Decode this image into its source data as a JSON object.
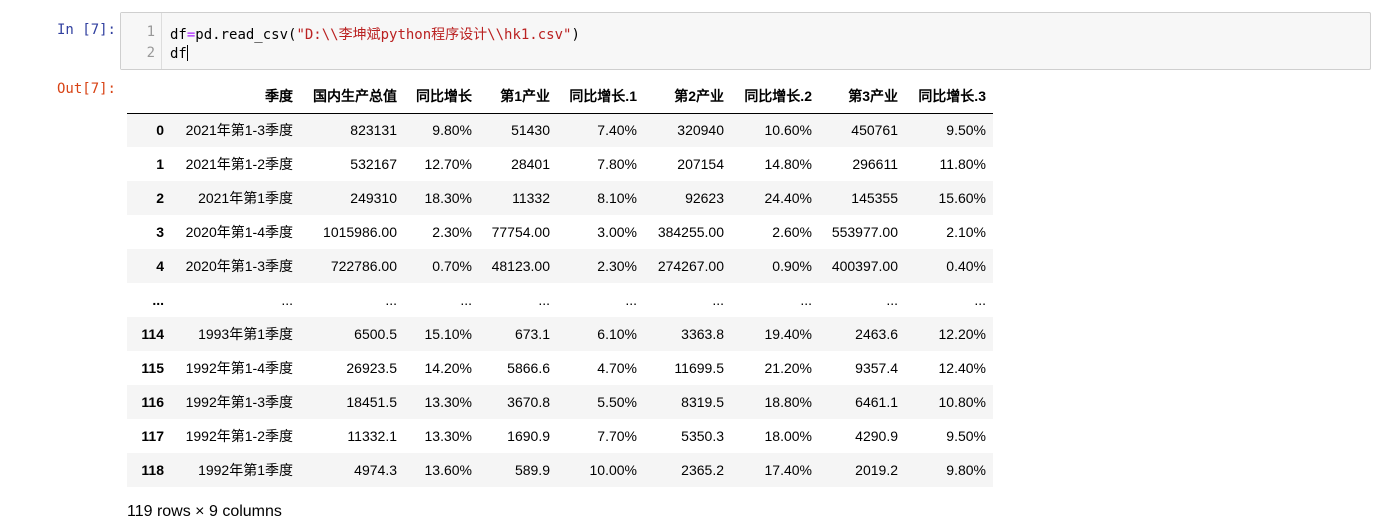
{
  "input_cell": {
    "prompt": "In  [7]:",
    "lines": [
      {
        "no": "1",
        "pre": "df",
        "op": "=",
        "mid": "pd.read_csv(",
        "str": "\"D:\\\\李坤斌python程序设计\\\\hk1.csv\"",
        "post": ")"
      },
      {
        "no": "2",
        "text": "df"
      }
    ]
  },
  "output_cell": {
    "prompt": "Out[7]:",
    "columns": [
      "",
      "季度",
      "国内生产总值",
      "同比增长",
      "第1产业",
      "同比增长.1",
      "第2产业",
      "同比增长.2",
      "第3产业",
      "同比增长.3"
    ],
    "rows": [
      [
        "0",
        "2021年第1-3季度",
        "823131",
        "9.80%",
        "51430",
        "7.40%",
        "320940",
        "10.60%",
        "450761",
        "9.50%"
      ],
      [
        "1",
        "2021年第1-2季度",
        "532167",
        "12.70%",
        "28401",
        "7.80%",
        "207154",
        "14.80%",
        "296611",
        "11.80%"
      ],
      [
        "2",
        "2021年第1季度",
        "249310",
        "18.30%",
        "11332",
        "8.10%",
        "92623",
        "24.40%",
        "145355",
        "15.60%"
      ],
      [
        "3",
        "2020年第1-4季度",
        "1015986.00",
        "2.30%",
        "77754.00",
        "3.00%",
        "384255.00",
        "2.60%",
        "553977.00",
        "2.10%"
      ],
      [
        "4",
        "2020年第1-3季度",
        "722786.00",
        "0.70%",
        "48123.00",
        "2.30%",
        "274267.00",
        "0.90%",
        "400397.00",
        "0.40%"
      ],
      [
        "...",
        "...",
        "...",
        "...",
        "...",
        "...",
        "...",
        "...",
        "...",
        "..."
      ],
      [
        "114",
        "1993年第1季度",
        "6500.5",
        "15.10%",
        "673.1",
        "6.10%",
        "3363.8",
        "19.40%",
        "2463.6",
        "12.20%"
      ],
      [
        "115",
        "1992年第1-4季度",
        "26923.5",
        "14.20%",
        "5866.6",
        "4.70%",
        "11699.5",
        "21.20%",
        "9357.4",
        "12.40%"
      ],
      [
        "116",
        "1992年第1-3季度",
        "18451.5",
        "13.30%",
        "3670.8",
        "5.50%",
        "8319.5",
        "18.80%",
        "6461.1",
        "10.80%"
      ],
      [
        "117",
        "1992年第1-2季度",
        "11332.1",
        "13.30%",
        "1690.9",
        "7.70%",
        "5350.3",
        "18.00%",
        "4290.9",
        "9.50%"
      ],
      [
        "118",
        "1992年第1季度",
        "4974.3",
        "13.60%",
        "589.9",
        "10.00%",
        "2365.2",
        "17.40%",
        "2019.2",
        "9.80%"
      ]
    ],
    "shape": "119 rows × 9 columns"
  }
}
